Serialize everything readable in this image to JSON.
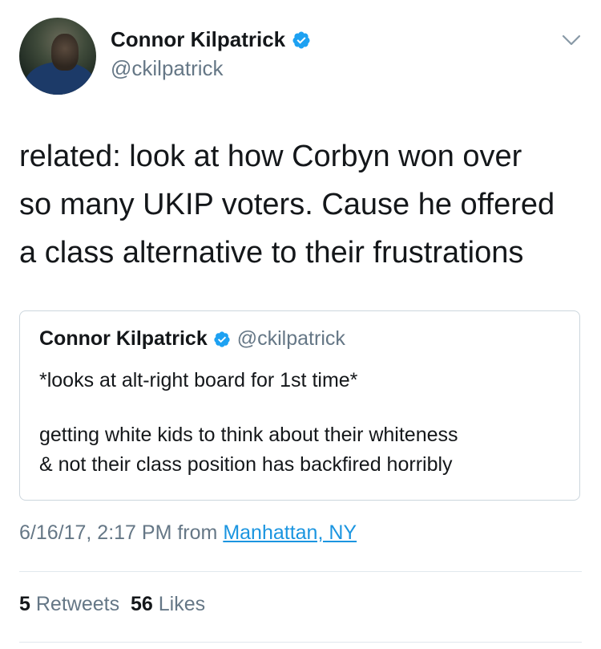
{
  "tweet": {
    "author": {
      "display_name": "Connor Kilpatrick",
      "handle": "@ckilpatrick",
      "verified_icon": "verified-badge-icon"
    },
    "text": "related: look at how Corbyn won over\nso many UKIP voters. Cause he offered\na class alternative to their frustrations",
    "menu_icon": "chevron-down-icon",
    "quoted_tweet": {
      "display_name": "Connor Kilpatrick",
      "handle": "@ckilpatrick",
      "line1": "*looks at alt-right board for 1st time*",
      "line2": "getting white kids to think about their whiteness\n& not their class position has backfired horribly"
    },
    "timestamp": "6/16/17, 2:17 PM from",
    "location": "Manhattan, NY",
    "stats": {
      "retweets_count": "5",
      "retweets_label": "Retweets",
      "likes_count": "56",
      "likes_label": "Likes"
    }
  },
  "colors": {
    "text": "#14171a",
    "secondary": "#657786",
    "link": "#1b95e0",
    "verified": "#1da1f2",
    "border": "#ccd6dd"
  }
}
